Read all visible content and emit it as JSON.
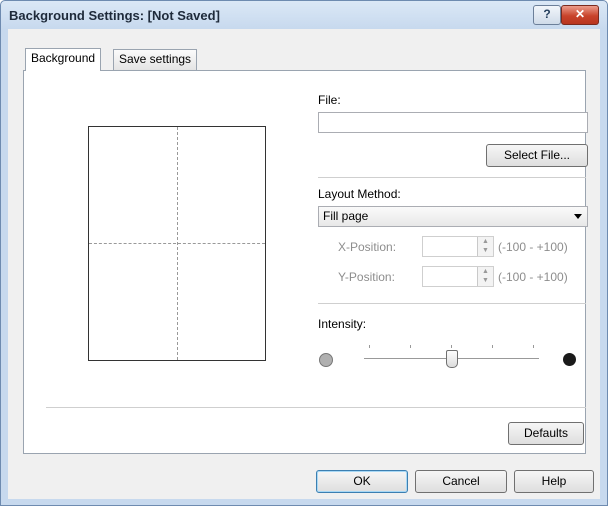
{
  "window": {
    "title": "Background Settings: [Not Saved]",
    "help_glyph": "?",
    "close_glyph": "✕"
  },
  "tabs": [
    {
      "label": "Background",
      "active": true
    },
    {
      "label": "Save settings",
      "active": false
    }
  ],
  "file": {
    "label": "File:",
    "value": "",
    "select_button": "Select File..."
  },
  "layout": {
    "label": "Layout Method:",
    "selected": "Fill page",
    "x_label": "X-Position:",
    "x_range": "(-100 - +100)",
    "y_label": "Y-Position:",
    "y_range": "(-100 - +100)"
  },
  "intensity": {
    "label": "Intensity:",
    "level_fraction": 0.5,
    "light_color": "#b0b0b0",
    "dark_color": "#1a1a1a"
  },
  "buttons": {
    "defaults": "Defaults",
    "ok": "OK",
    "cancel": "Cancel",
    "help": "Help"
  },
  "icons": {
    "dropdown": "chevron-down-icon",
    "spin_up": "▲",
    "spin_down": "▼"
  }
}
